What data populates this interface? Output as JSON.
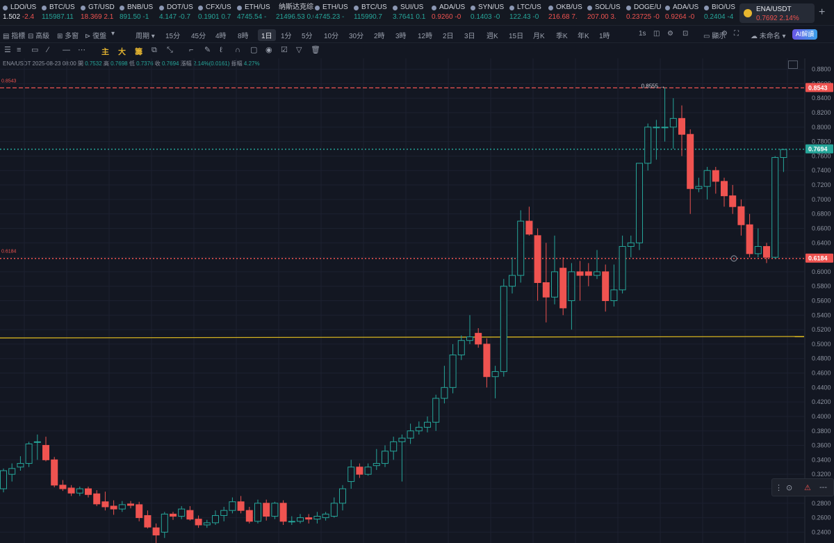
{
  "tickers": [
    {
      "symbol": "LDO/US",
      "price": "1.502",
      "change": "-2.4",
      "dir": "down",
      "x": 4
    },
    {
      "symbol": "BTC/US",
      "price": "115987.11",
      "change": "",
      "dir": "up",
      "x": 60
    },
    {
      "symbol": "GT/USD",
      "price": "18.369",
      "change": "2.1",
      "dir": "down",
      "x": 116
    },
    {
      "symbol": "BNB/US",
      "price": "891.50",
      "change": "-1",
      "dir": "up",
      "x": 172
    },
    {
      "symbol": "DOT/US",
      "price": "4.147",
      "change": "-0.7",
      "dir": "up",
      "x": 229
    },
    {
      "symbol": "CFX/US",
      "price": "0.1901",
      "change": "0.7",
      "dir": "up",
      "x": 285
    },
    {
      "symbol": "ETH/US",
      "price": "4745.54",
      "change": "-",
      "dir": "up",
      "x": 341
    },
    {
      "symbol": "纳斯达克综合",
      "price": "21496.53",
      "change": "0.0",
      "dir": "up",
      "x": 397
    },
    {
      "symbol": "ETH/US",
      "price": "4745.23",
      "change": "-",
      "dir": "up",
      "x": 453
    },
    {
      "symbol": "BTC/US",
      "price": "115990.7",
      "change": "",
      "dir": "up",
      "x": 509
    },
    {
      "symbol": "SUI/US",
      "price": "3.7641",
      "change": "0.1",
      "dir": "up",
      "x": 565
    },
    {
      "symbol": "ADA/US",
      "price": "0.9260",
      "change": "-0",
      "dir": "down",
      "x": 621
    },
    {
      "symbol": "SYN/US",
      "price": "0.1403",
      "change": "-0",
      "dir": "up",
      "x": 677
    },
    {
      "symbol": "LTC/US",
      "price": "122.43",
      "change": "-0",
      "dir": "up",
      "x": 733
    },
    {
      "symbol": "OKB/US",
      "price": "216.68",
      "change": "7.",
      "dir": "down",
      "x": 789
    },
    {
      "symbol": "SOL/US",
      "price": "207.00",
      "change": "3.",
      "dir": "down",
      "x": 845
    },
    {
      "symbol": "DOGE/U",
      "price": "0.23725",
      "change": "-0",
      "dir": "down",
      "x": 901
    },
    {
      "symbol": "ADA/US",
      "price": "0.9264",
      "change": "-0",
      "dir": "down",
      "x": 957
    },
    {
      "symbol": "BIO/US",
      "price": "0.2404",
      "change": "-4",
      "dir": "up",
      "x": 1013
    }
  ],
  "active_pair": {
    "name": "ENA/USDT",
    "price": "0.7692",
    "change": "2.14%"
  },
  "toolbar": {
    "left": [
      "指標",
      "高級",
      "多窗",
      "復盤"
    ],
    "periods": [
      "周期",
      "15分",
      "45分",
      "4時",
      "8時",
      "1日",
      "1分",
      "5分",
      "10分",
      "30分",
      "2時",
      "3時",
      "12時",
      "2日",
      "3日",
      "週K",
      "15日",
      "月K",
      "季K",
      "年K",
      "1時"
    ],
    "active_period": "1日",
    "right": [
      "1s",
      "顯示",
      "未命名"
    ],
    "ai_label": "AI解讀"
  },
  "drawing": {
    "main_labels": [
      "主",
      "大",
      "籌"
    ]
  },
  "legend": {
    "pair": "ENA/USDT",
    "date": "2025-08-23 08:00",
    "open_label": "開",
    "open": "0.7532",
    "high_label": "高",
    "high": "0.7698",
    "low_label": "低",
    "low": "0.7376",
    "close_label": "收",
    "close": "0.7694",
    "change_label": "漲幅",
    "change": "2.14%(0.0161)",
    "amp_label": "振幅",
    "amp": "4.27%"
  },
  "chart_data": {
    "type": "candlestick",
    "y_ticks": [
      0.24,
      0.26,
      0.28,
      0.3,
      0.32,
      0.34,
      0.36,
      0.38,
      0.4,
      0.42,
      0.44,
      0.46,
      0.48,
      0.5,
      0.52,
      0.54,
      0.56,
      0.58,
      0.6,
      0.62,
      0.64,
      0.66,
      0.68,
      0.7,
      0.72,
      0.74,
      0.76,
      0.78,
      0.8,
      0.82,
      0.84,
      0.86,
      0.88
    ],
    "ylim": [
      0.225,
      0.895
    ],
    "hlines": [
      {
        "value": 0.8543,
        "label": "0.8543",
        "color": "#ef5350",
        "style": "dashed",
        "left_label": "0.8543"
      },
      {
        "value": 0.7694,
        "label": "0.7694",
        "color": "#26a69a",
        "style": "dotted"
      },
      {
        "value": 0.6184,
        "label": "0.6184",
        "color": "#ef5350",
        "style": "dotted",
        "left_label": "0.6184"
      }
    ],
    "trendline": {
      "y_start": 0.5085,
      "y_end": 0.5105,
      "color": "#d4b21f"
    },
    "high_marker": "0.8555",
    "low_marker": "0.2224",
    "candles": [
      [
        0.3,
        0.325,
        0.295,
        0.328
      ],
      [
        0.32,
        0.328,
        0.31,
        0.335
      ],
      [
        0.33,
        0.335,
        0.325,
        0.345
      ],
      [
        0.335,
        0.362,
        0.33,
        0.365
      ],
      [
        0.365,
        0.365,
        0.34,
        0.375
      ],
      [
        0.36,
        0.34,
        0.338,
        0.372
      ],
      [
        0.34,
        0.305,
        0.302,
        0.344
      ],
      [
        0.305,
        0.3,
        0.297,
        0.312
      ],
      [
        0.301,
        0.294,
        0.29,
        0.305
      ],
      [
        0.294,
        0.3,
        0.29,
        0.303
      ],
      [
        0.3,
        0.292,
        0.288,
        0.303
      ],
      [
        0.293,
        0.279,
        0.276,
        0.298
      ],
      [
        0.282,
        0.275,
        0.27,
        0.296
      ],
      [
        0.276,
        0.272,
        0.264,
        0.284
      ],
      [
        0.272,
        0.278,
        0.268,
        0.283
      ],
      [
        0.279,
        0.277,
        0.273,
        0.283
      ],
      [
        0.278,
        0.26,
        0.255,
        0.282
      ],
      [
        0.263,
        0.247,
        0.245,
        0.27
      ],
      [
        0.246,
        0.236,
        0.222,
        0.252
      ],
      [
        0.24,
        0.265,
        0.232,
        0.268
      ],
      [
        0.265,
        0.262,
        0.257,
        0.268
      ],
      [
        0.262,
        0.272,
        0.258,
        0.276
      ],
      [
        0.27,
        0.258,
        0.256,
        0.276
      ],
      [
        0.258,
        0.25,
        0.246,
        0.263
      ],
      [
        0.25,
        0.253,
        0.246,
        0.257
      ],
      [
        0.253,
        0.263,
        0.25,
        0.27
      ],
      [
        0.263,
        0.27,
        0.255,
        0.275
      ],
      [
        0.27,
        0.282,
        0.266,
        0.288
      ],
      [
        0.282,
        0.27,
        0.266,
        0.29
      ],
      [
        0.27,
        0.255,
        0.252,
        0.275
      ],
      [
        0.255,
        0.28,
        0.252,
        0.285
      ],
      [
        0.28,
        0.262,
        0.256,
        0.285
      ],
      [
        0.262,
        0.28,
        0.258,
        0.282
      ],
      [
        0.28,
        0.255,
        0.25,
        0.284
      ],
      [
        0.255,
        0.255,
        0.25,
        0.262
      ],
      [
        0.255,
        0.26,
        0.252,
        0.265
      ],
      [
        0.26,
        0.258,
        0.252,
        0.265
      ],
      [
        0.258,
        0.262,
        0.252,
        0.268
      ],
      [
        0.26,
        0.265,
        0.256,
        0.268
      ],
      [
        0.262,
        0.28,
        0.26,
        0.288
      ],
      [
        0.28,
        0.3,
        0.27,
        0.305
      ],
      [
        0.31,
        0.33,
        0.3,
        0.34
      ],
      [
        0.33,
        0.32,
        0.315,
        0.335
      ],
      [
        0.32,
        0.33,
        0.318,
        0.335
      ],
      [
        0.332,
        0.335,
        0.326,
        0.355
      ],
      [
        0.335,
        0.352,
        0.33,
        0.36
      ],
      [
        0.352,
        0.365,
        0.34,
        0.372
      ],
      [
        0.365,
        0.37,
        0.31,
        0.375
      ],
      [
        0.37,
        0.38,
        0.362,
        0.39
      ],
      [
        0.38,
        0.385,
        0.375,
        0.393
      ],
      [
        0.385,
        0.392,
        0.378,
        0.4
      ],
      [
        0.392,
        0.425,
        0.38,
        0.43
      ],
      [
        0.425,
        0.44,
        0.418,
        0.47
      ],
      [
        0.44,
        0.485,
        0.432,
        0.5
      ],
      [
        0.485,
        0.505,
        0.478,
        0.512
      ],
      [
        0.505,
        0.51,
        0.5,
        0.54
      ],
      [
        0.515,
        0.5,
        0.495,
        0.522
      ],
      [
        0.5,
        0.455,
        0.44,
        0.508
      ],
      [
        0.455,
        0.462,
        0.425,
        0.47
      ],
      [
        0.462,
        0.58,
        0.455,
        0.59
      ],
      [
        0.58,
        0.595,
        0.57,
        0.62
      ],
      [
        0.595,
        0.67,
        0.585,
        0.685
      ],
      [
        0.67,
        0.652,
        0.65,
        0.69
      ],
      [
        0.65,
        0.585,
        0.56,
        0.66
      ],
      [
        0.585,
        0.565,
        0.53,
        0.64
      ],
      [
        0.565,
        0.6,
        0.555,
        0.65
      ],
      [
        0.605,
        0.55,
        0.54,
        0.62
      ],
      [
        0.56,
        0.6,
        0.52,
        0.612
      ],
      [
        0.6,
        0.595,
        0.56,
        0.615
      ],
      [
        0.6,
        0.595,
        0.58,
        0.612
      ],
      [
        0.595,
        0.6,
        0.59,
        0.63
      ],
      [
        0.6,
        0.56,
        0.545,
        0.61
      ],
      [
        0.56,
        0.575,
        0.552,
        0.61
      ],
      [
        0.575,
        0.635,
        0.57,
        0.65
      ],
      [
        0.635,
        0.64,
        0.62,
        0.65
      ],
      [
        0.64,
        0.75,
        0.63,
        0.75
      ],
      [
        0.75,
        0.8,
        0.74,
        0.805
      ],
      [
        0.8,
        0.8,
        0.755,
        0.81
      ],
      [
        0.8,
        0.8,
        0.78,
        0.855
      ],
      [
        0.8,
        0.812,
        0.77,
        0.84
      ],
      [
        0.812,
        0.79,
        0.76,
        0.83
      ],
      [
        0.79,
        0.715,
        0.68,
        0.797
      ],
      [
        0.715,
        0.718,
        0.71,
        0.73
      ],
      [
        0.718,
        0.74,
        0.7,
        0.745
      ],
      [
        0.74,
        0.725,
        0.708,
        0.745
      ],
      [
        0.725,
        0.705,
        0.69,
        0.73
      ],
      [
        0.705,
        0.69,
        0.68,
        0.72
      ],
      [
        0.69,
        0.665,
        0.65,
        0.7
      ],
      [
        0.665,
        0.625,
        0.62,
        0.68
      ],
      [
        0.625,
        0.635,
        0.62,
        0.66
      ],
      [
        0.635,
        0.62,
        0.612,
        0.64
      ],
      [
        0.62,
        0.758,
        0.618,
        0.76
      ],
      [
        0.758,
        0.769,
        0.738,
        0.77
      ]
    ]
  }
}
